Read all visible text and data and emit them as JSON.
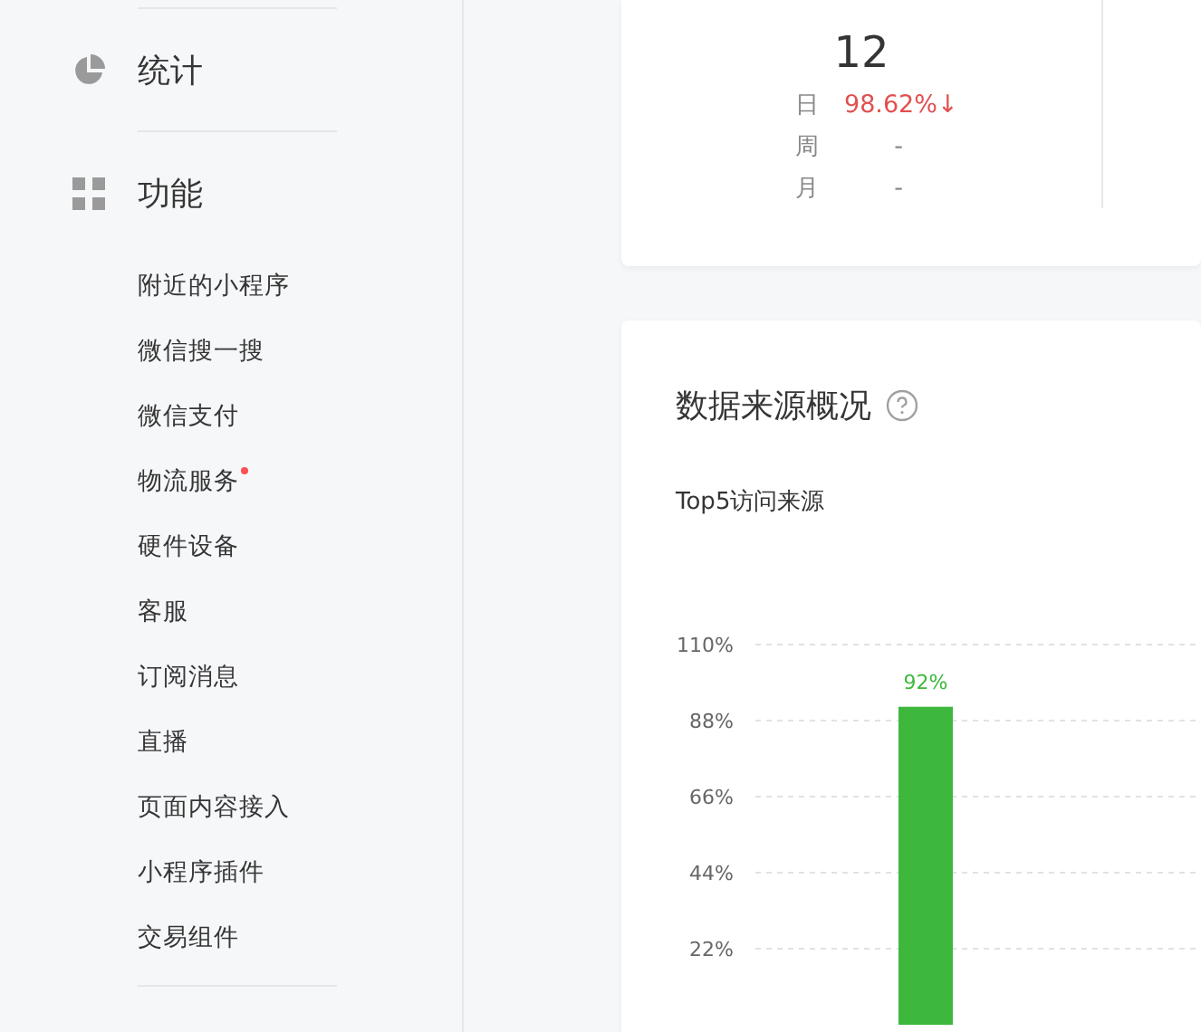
{
  "sidebar": {
    "sections": [
      {
        "kind": "stats",
        "label": "统计"
      },
      {
        "kind": "features",
        "label": "功能",
        "children": [
          {
            "label": "附近的小程序",
            "badge": false
          },
          {
            "label": "微信搜一搜",
            "badge": false
          },
          {
            "label": "微信支付",
            "badge": false
          },
          {
            "label": "物流服务",
            "badge": true
          },
          {
            "label": "硬件设备",
            "badge": false
          },
          {
            "label": "客服",
            "badge": false
          },
          {
            "label": "订阅消息",
            "badge": false
          },
          {
            "label": "直播",
            "badge": false
          },
          {
            "label": "页面内容接入",
            "badge": false
          },
          {
            "label": "小程序插件",
            "badge": false
          },
          {
            "label": "交易组件",
            "badge": false
          }
        ]
      }
    ]
  },
  "summary_card": {
    "value": "12",
    "rows": [
      {
        "label": "日",
        "value": "98.62%↓",
        "color": "#e15050"
      },
      {
        "label": "周",
        "value": "-",
        "color": "#888888"
      },
      {
        "label": "月",
        "value": "-",
        "color": "#888888"
      }
    ]
  },
  "source_card": {
    "title": "数据来源概况",
    "subtitle": "Top5访问来源",
    "chart_data": {
      "type": "bar",
      "values": [
        92
      ],
      "ylim": [
        0,
        110
      ],
      "grid": true,
      "yticks": [
        {
          "value": 22,
          "label": "22%"
        },
        {
          "value": 44,
          "label": "44%"
        },
        {
          "value": 66,
          "label": "66%"
        },
        {
          "value": 88,
          "label": "88%"
        },
        {
          "value": 110,
          "label": "110%"
        }
      ],
      "value_labels": [
        "92%"
      ]
    }
  }
}
